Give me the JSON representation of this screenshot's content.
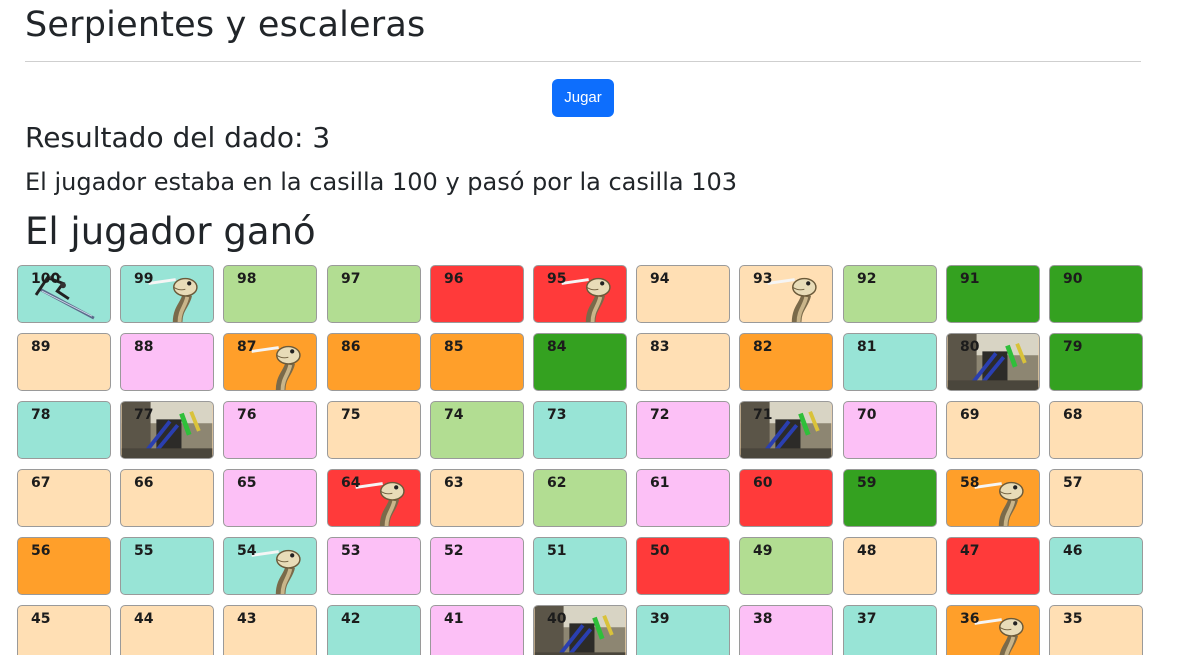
{
  "title": "Serpientes y escaleras",
  "play_button": "Jugar",
  "dice_result": "Resultado del dado: 3",
  "move_text": "El jugador estaba en la casilla 100 y pasó por la casilla 103",
  "status_text": "El jugador ganó",
  "colors": {
    "teal": "#98e4d6",
    "lightgreen": "#b2dd92",
    "red": "#ff3a3a",
    "peach": "#ffdfb4",
    "darkgreen": "#34a120",
    "pink": "#fcc0f6",
    "orange": "#ff9f2a",
    "button": "#0d6efd"
  },
  "board": {
    "rows": [
      [
        {
          "n": "100",
          "color": "teal",
          "icon": "sword-player-icon"
        },
        {
          "n": "99",
          "color": "teal",
          "icon": "snake-icon"
        },
        {
          "n": "98",
          "color": "lightgreen"
        },
        {
          "n": "97",
          "color": "lightgreen"
        },
        {
          "n": "96",
          "color": "red"
        },
        {
          "n": "95",
          "color": "red",
          "icon": "snake-icon"
        },
        {
          "n": "94",
          "color": "peach"
        },
        {
          "n": "93",
          "color": "peach",
          "icon": "snake-icon"
        },
        {
          "n": "92",
          "color": "lightgreen"
        },
        {
          "n": "91",
          "color": "darkgreen"
        },
        {
          "n": "90",
          "color": "darkgreen"
        }
      ],
      [
        {
          "n": "89",
          "color": "peach"
        },
        {
          "n": "88",
          "color": "pink"
        },
        {
          "n": "87",
          "color": "orange",
          "icon": "snake-icon"
        },
        {
          "n": "86",
          "color": "orange"
        },
        {
          "n": "85",
          "color": "orange"
        },
        {
          "n": "84",
          "color": "darkgreen"
        },
        {
          "n": "83",
          "color": "peach"
        },
        {
          "n": "82",
          "color": "orange"
        },
        {
          "n": "81",
          "color": "teal"
        },
        {
          "n": "80",
          "color": "peach",
          "icon": "ladder-photo-icon"
        },
        {
          "n": "79",
          "color": "darkgreen"
        }
      ],
      [
        {
          "n": "78",
          "color": "teal"
        },
        {
          "n": "77",
          "color": "peach",
          "icon": "ladder-photo-icon"
        },
        {
          "n": "76",
          "color": "pink"
        },
        {
          "n": "75",
          "color": "peach"
        },
        {
          "n": "74",
          "color": "lightgreen"
        },
        {
          "n": "73",
          "color": "teal"
        },
        {
          "n": "72",
          "color": "pink"
        },
        {
          "n": "71",
          "color": "peach",
          "icon": "ladder-photo-icon"
        },
        {
          "n": "70",
          "color": "pink"
        },
        {
          "n": "69",
          "color": "peach"
        },
        {
          "n": "68",
          "color": "peach"
        }
      ],
      [
        {
          "n": "67",
          "color": "peach"
        },
        {
          "n": "66",
          "color": "peach"
        },
        {
          "n": "65",
          "color": "pink"
        },
        {
          "n": "64",
          "color": "red",
          "icon": "snake-icon"
        },
        {
          "n": "63",
          "color": "peach"
        },
        {
          "n": "62",
          "color": "lightgreen"
        },
        {
          "n": "61",
          "color": "pink"
        },
        {
          "n": "60",
          "color": "red"
        },
        {
          "n": "59",
          "color": "darkgreen"
        },
        {
          "n": "58",
          "color": "orange",
          "icon": "snake-icon"
        },
        {
          "n": "57",
          "color": "peach"
        }
      ],
      [
        {
          "n": "56",
          "color": "orange"
        },
        {
          "n": "55",
          "color": "teal"
        },
        {
          "n": "54",
          "color": "teal",
          "icon": "snake-icon"
        },
        {
          "n": "53",
          "color": "pink"
        },
        {
          "n": "52",
          "color": "pink"
        },
        {
          "n": "51",
          "color": "teal"
        },
        {
          "n": "50",
          "color": "red"
        },
        {
          "n": "49",
          "color": "lightgreen"
        },
        {
          "n": "48",
          "color": "peach"
        },
        {
          "n": "47",
          "color": "red"
        },
        {
          "n": "46",
          "color": "teal"
        }
      ],
      [
        {
          "n": "45",
          "color": "peach"
        },
        {
          "n": "44",
          "color": "peach"
        },
        {
          "n": "43",
          "color": "peach"
        },
        {
          "n": "42",
          "color": "teal"
        },
        {
          "n": "41",
          "color": "pink"
        },
        {
          "n": "40",
          "color": "peach",
          "icon": "ladder-photo-icon"
        },
        {
          "n": "39",
          "color": "teal"
        },
        {
          "n": "38",
          "color": "pink"
        },
        {
          "n": "37",
          "color": "teal"
        },
        {
          "n": "36",
          "color": "orange",
          "icon": "snake-icon"
        },
        {
          "n": "35",
          "color": "peach"
        }
      ]
    ]
  }
}
